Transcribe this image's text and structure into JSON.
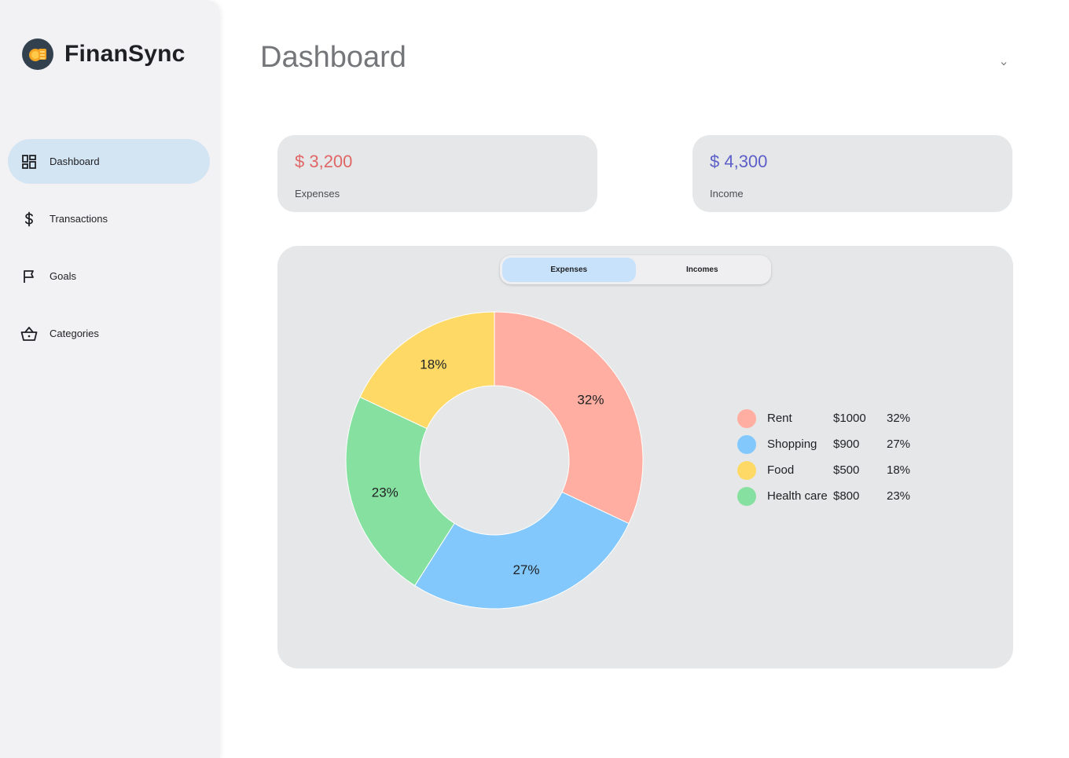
{
  "brand": {
    "name": "FinanSync",
    "logo_icon": "coin-icon"
  },
  "sidebar": {
    "items": [
      {
        "label": "Dashboard",
        "icon": "dashboard-icon",
        "active": true
      },
      {
        "label": "Transactions",
        "icon": "dollar-icon",
        "active": false
      },
      {
        "label": "Goals",
        "icon": "flag-icon",
        "active": false
      },
      {
        "label": "Categories",
        "icon": "basket-icon",
        "active": false
      }
    ]
  },
  "header": {
    "title": "Dashboard",
    "menu_icon": "chevron-down-icon"
  },
  "cards": {
    "expenses": {
      "amount": "$ 3,200",
      "label": "Expenses",
      "color": "#e06666"
    },
    "income": {
      "amount": "$ 4,300",
      "label": "Income",
      "color": "#5b5fc7"
    }
  },
  "toggle": {
    "options": [
      "Expenses",
      "Incomes"
    ],
    "selected": "Expenses"
  },
  "chart_data": {
    "type": "pie",
    "style": "donut",
    "categories": [
      "Rent",
      "Shopping",
      "Health care",
      "Food"
    ],
    "values": [
      32,
      27,
      23,
      18
    ],
    "data_labels": [
      "32%",
      "27%",
      "23%",
      "18%"
    ],
    "colors": [
      "#ffaea1",
      "#82c8fd",
      "#86e0a0",
      "#fed966"
    ]
  },
  "legend": [
    {
      "name": "Rent",
      "amount": "$1000",
      "pct": "32%",
      "color": "#ffaea1"
    },
    {
      "name": "Shopping",
      "amount": "$900",
      "pct": "27%",
      "color": "#82c8fd"
    },
    {
      "name": "Food",
      "amount": "$500",
      "pct": "18%",
      "color": "#fed966"
    },
    {
      "name": "Health care",
      "amount": "$800",
      "pct": "23%",
      "color": "#86e0a0"
    }
  ]
}
